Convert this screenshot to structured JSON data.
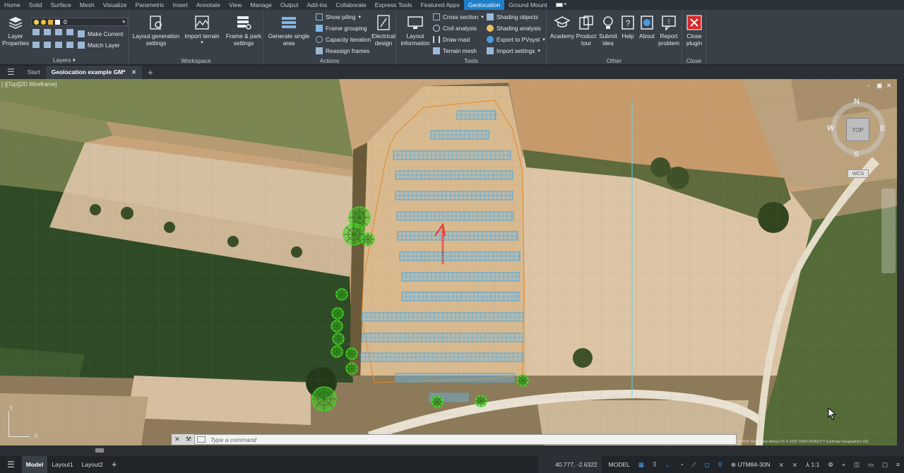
{
  "menubar": {
    "tabs": [
      "Home",
      "Solid",
      "Surface",
      "Mesh",
      "Visualize",
      "Parametric",
      "Insert",
      "Annotate",
      "View",
      "Manage",
      "Output",
      "Add-ins",
      "Collaborate",
      "Express Tools",
      "Featured Apps",
      "Geolocation",
      "Ground Mount"
    ],
    "active_tab": "Geolocation"
  },
  "ribbon": {
    "layers": {
      "title": "Layers",
      "layer_properties": "Layer\nProperties",
      "current_layer": "0",
      "make_current": "Make Current",
      "match_layer": "Match Layer"
    },
    "workspace": {
      "title": "Workspace",
      "layout_generation": "Layout generation\nsettings",
      "import_terrain": "Import terrain",
      "frame_park": "Frame & park\nsettings"
    },
    "actions": {
      "title": "Actions",
      "generate_single": "Generate single\narea",
      "show_piling": "Show piling",
      "frame_grouping": "Frame grouping",
      "capacity_iteration": "Capacity iteration",
      "reassign_frames": "Reassign frames",
      "electrical_design": "Electrical\ndesign"
    },
    "tools": {
      "title": "Tools",
      "layout_information": "Layout\ninformation",
      "cross_section": "Cross section",
      "civil_analysis": "Civil analysis",
      "draw_road": "Draw road",
      "terrain_mesh": "Terrain mesh",
      "shading_objects": "Shading objects",
      "shading_analysis": "Shading analysis",
      "export_pvsyst": "Export to PVsyst",
      "import_settings": "Import settings"
    },
    "other": {
      "title": "Other",
      "academy": "Academy",
      "product_tour": "Product\ntour",
      "submit_idea": "Submit\nidea",
      "help": "Help",
      "about": "About",
      "report_problem": "Report\nproblem"
    },
    "close": {
      "title": "Close",
      "close_plugin": "Close\nplugin"
    }
  },
  "doc_tabs": {
    "start": "Start",
    "active": "Geolocation example GM*"
  },
  "viewport": {
    "label": "[-][Top][2D Wireframe]",
    "compass": {
      "n": "N",
      "s": "S",
      "e": "E",
      "w": "W",
      "face": "TOP"
    },
    "wcs": "WCS",
    "ucs_x": "X",
    "ucs_y": "Y",
    "attribution": "© 2026 Distribution Airbus DS © 2026 TMAP MOBILITY Earthstar Geographics SIO"
  },
  "command": {
    "placeholder": "Type a command"
  },
  "status": {
    "tabs": [
      "Model",
      "Layout1",
      "Layout2"
    ],
    "coords": "40.777, -2.6322",
    "model": "MODEL",
    "cs": "UTM84-30N",
    "scale": "1:1"
  }
}
